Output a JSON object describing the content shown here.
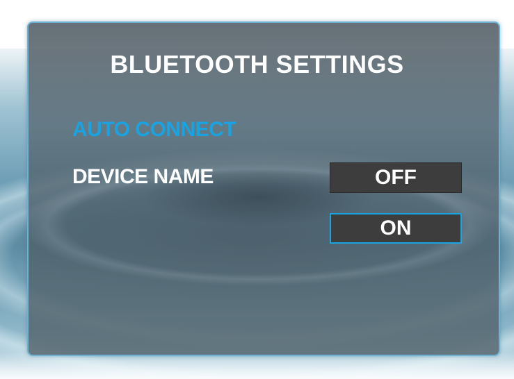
{
  "screen": {
    "title": "BLUETOOTH SETTINGS"
  },
  "menu": {
    "items": [
      {
        "label": "AUTO CONNECT",
        "state": "highlighted"
      },
      {
        "label": "DEVICE NAME",
        "state": "normal"
      }
    ]
  },
  "options": [
    {
      "label": "OFF",
      "selected": false
    },
    {
      "label": "ON",
      "selected": true
    }
  ],
  "colors": {
    "highlight": "#1aa3e0",
    "text": "#ffffff",
    "option_bg": "#3d3d3d",
    "panel_border": "#6fb2d4"
  }
}
